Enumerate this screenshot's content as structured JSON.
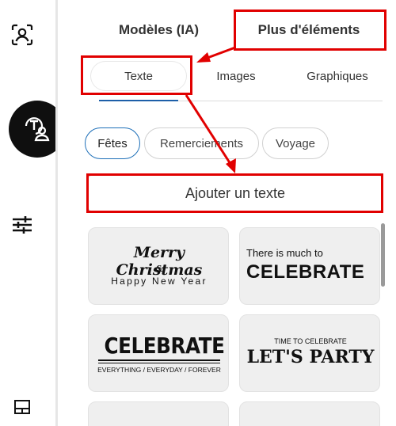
{
  "rail": {
    "items": [
      {
        "icon": "profile-frame-icon"
      },
      {
        "icon": "text-person-icon",
        "active": true
      },
      {
        "icon": "sliders-icon"
      },
      {
        "icon": "layout-bottom-icon"
      }
    ]
  },
  "top_tabs": [
    {
      "label": "Modèles (IA)"
    },
    {
      "label": "Plus d'éléments",
      "active": true
    }
  ],
  "sub_tabs": [
    {
      "label": "Texte",
      "active": true
    },
    {
      "label": "Images"
    },
    {
      "label": "Graphiques"
    }
  ],
  "chips": [
    {
      "label": "Fêtes",
      "active": true
    },
    {
      "label": "Remerciements"
    },
    {
      "label": "Voyage"
    }
  ],
  "add_text_button": "Ajouter un texte",
  "templates": {
    "merry": {
      "line1": "Merry Christmas",
      "line2": "&",
      "line3": "Happy New Year"
    },
    "much": {
      "line1": "There is much to",
      "line2": "CELEBRATE"
    },
    "celebrate": {
      "line1": "CELEBRATE",
      "line2": "EVERYTHING / EVERYDAY / FOREVER"
    },
    "party": {
      "line1": "TIME TO CELEBRATE",
      "line2": "LET'S PARTY"
    }
  },
  "colors": {
    "highlight": "#e10000",
    "accent": "#1d6fb8"
  }
}
